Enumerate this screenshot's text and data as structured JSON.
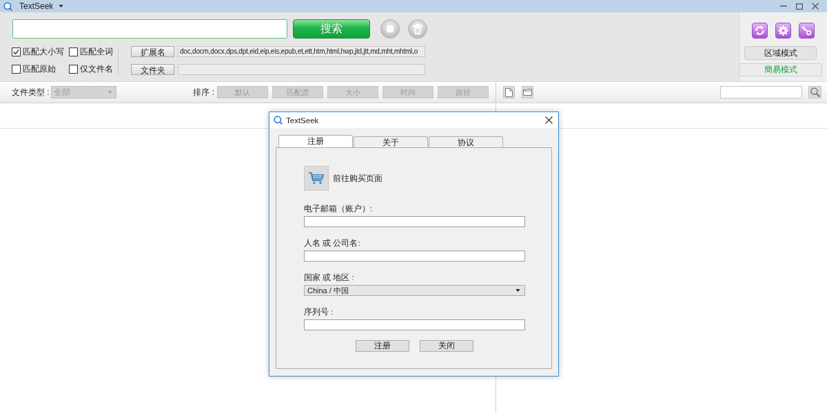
{
  "window": {
    "title": "TextSeek"
  },
  "search": {
    "button": "搜索"
  },
  "options": [
    {
      "label": "匹配大小写",
      "checked": true
    },
    {
      "label": "匹配全词",
      "checked": false
    },
    {
      "label": "匹配原始",
      "checked": false
    },
    {
      "label": "仅文件名",
      "checked": false
    }
  ],
  "filters": [
    {
      "label": "扩展名",
      "value": "doc,docm,docx,dps,dpt,eid,eip,eis,epub,et,ett,htm,html,hwp,jtd,jtt,md,mht,mhtml,o"
    },
    {
      "label": "文件夹"
    }
  ],
  "mode_buttons": [
    {
      "label": "区域模式",
      "selected": false
    },
    {
      "label": "簡易模式",
      "selected": true
    }
  ],
  "toolbar": {
    "file_type": {
      "label": "文件类型 :",
      "value": "全部",
      "disabled": true
    },
    "sort": {
      "label": "排序 :",
      "disabled": true,
      "buttons": [
        "默认",
        "匹配度",
        "大小",
        "时间",
        "路径"
      ]
    }
  },
  "dialog": {
    "title": "TextSeek",
    "tabs": [
      {
        "label": "注册",
        "selected": true
      },
      {
        "label": "关于",
        "selected": false
      },
      {
        "label": "协议",
        "selected": false
      }
    ],
    "buy_link": "前往购买页面",
    "fields": [
      {
        "kind": "text",
        "label": "电子邮箱（账户）:"
      },
      {
        "kind": "text",
        "label": "人名 或 公司名:"
      },
      {
        "kind": "select",
        "label": "国家 或 地区 :",
        "value": "China / 中国"
      },
      {
        "kind": "text",
        "label": "序列号 :"
      }
    ],
    "buttons": [
      "注册",
      "关闭"
    ]
  }
}
